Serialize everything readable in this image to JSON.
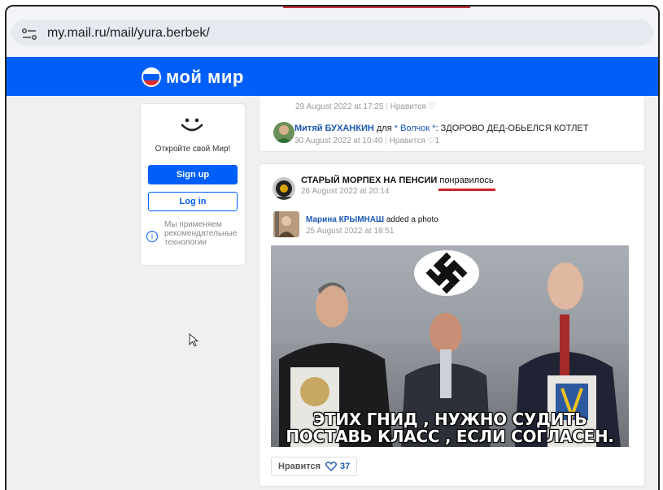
{
  "browser": {
    "url": "my.mail.ru/mail/yura.berbek/"
  },
  "header": {
    "logo_text": "мой мир",
    "brand_color": "#005ff9"
  },
  "sidebar": {
    "title": "Откройте свой Мир!",
    "signup_label": "Sign up",
    "login_label": "Log in",
    "info_text": "Мы применяем рекомендательные технологии",
    "info_icon": "i"
  },
  "post1": {
    "date_line": "29 August 2022 at 17:25",
    "like_label": "Нравится",
    "comment": {
      "author": "Митяй БУХАНКИН",
      "for_word": "для",
      "addressee": "* Волчок *",
      "text": ": ЗДОРОВО ДЕД-ОБЬЕЛСЯ КОТЛЕТ",
      "date": "30 August 2022 at 10:40",
      "like_label": "Нравится",
      "like_count": "1"
    }
  },
  "post2": {
    "author": "СТАРЫЙ МОРПЕХ НА ПЕНСИИ",
    "action": "понравилось",
    "date": "26 August 2022 at 20:14",
    "inner": {
      "author": "Марина КРЫМНАШ",
      "action": "added a photo",
      "date": "25 August 2022 at 18:51"
    },
    "photo_caption_line1": "ЭТИХ ГНИД , НУЖНО СУДИТЬ",
    "photo_caption_line2": "ПОСТАВЬ КЛАСС , ЕСЛИ СОГЛАСЕН.",
    "like_label": "Нравится",
    "like_count": "37"
  }
}
